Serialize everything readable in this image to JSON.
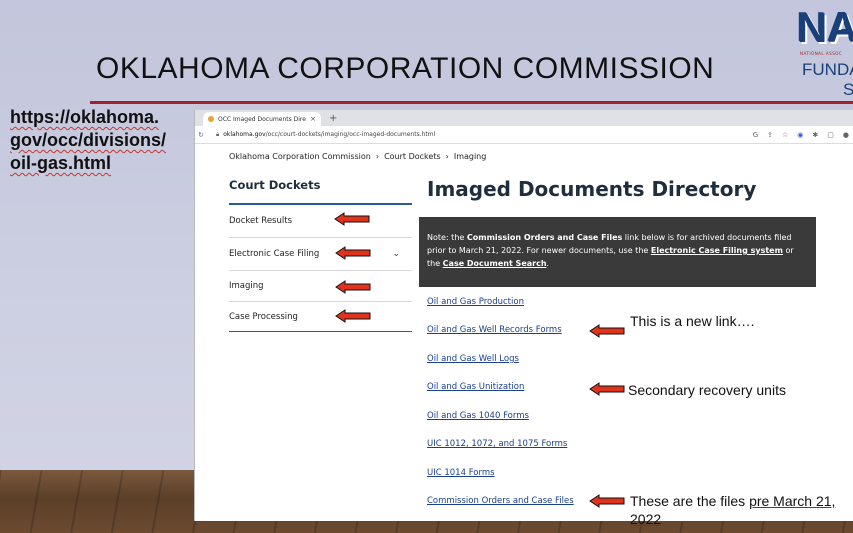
{
  "slide": {
    "title": "OKLAHOMA CORPORATION COMMISSION",
    "url_lines": [
      "https://oklahoma.",
      "gov/occ/divisions/",
      "oil-gas.html"
    ],
    "brand": {
      "logo_text": "NA",
      "tagline": "NATIONAL ASSOC",
      "line1": "FUNDA",
      "line2": "S"
    }
  },
  "browser": {
    "tab_title": "OCC Imaged Documents Direc",
    "tab_close": "×",
    "new_tab": "+",
    "address": "oklahoma.gov/occ/court-dockets/imaging/occ-imaged-documents.html",
    "address_domain": "oklahoma.gov",
    "address_path": "/occ/court-dockets/imaging/occ-imaged-documents.html"
  },
  "page": {
    "breadcrumb": [
      "Oklahoma Corporation Commission",
      "Court Dockets",
      "Imaging"
    ],
    "sidebar": {
      "heading": "Court Dockets",
      "items": [
        {
          "label": "Docket Results"
        },
        {
          "label": "Electronic Case Filing"
        },
        {
          "label": "Imaging"
        },
        {
          "label": "Case Processing"
        }
      ]
    },
    "heading": "Imaged Documents Directory",
    "note": {
      "prefix": "Note: the ",
      "bold": "Commission Orders and Case Files",
      "middle": " link below is for archived documents filed prior to March 21, 2022. For newer documents, use the ",
      "link1": "Electronic Case Filing system",
      "or": " or the ",
      "link2": "Case Document Search",
      "end": "."
    },
    "links": [
      "Oil and Gas Production",
      "Oil and Gas Well Records Forms",
      "Oil and Gas Well Logs",
      "Oil and Gas Unitization",
      "Oil and Gas 1040 Forms",
      "UIC 1012, 1072, and 1075 Forms",
      "UIC 1014 Forms",
      "Commission Orders and Case Files"
    ]
  },
  "annotations": {
    "new_link": "This is a new link….",
    "secondary": "Secondary recovery units",
    "files_prefix": "These are the files ",
    "files_underlined": "pre March 21, 2022"
  },
  "colors": {
    "arrow_fill": "#e0321c",
    "arrow_stroke": "#111111",
    "title_rule": "#a3202e",
    "link": "#1a3f8b"
  }
}
